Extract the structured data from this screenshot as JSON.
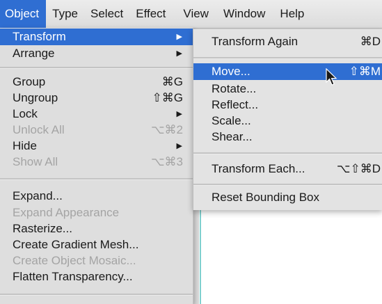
{
  "menubar": {
    "items": [
      {
        "label": "Object"
      },
      {
        "label": "Type"
      },
      {
        "label": "Select"
      },
      {
        "label": "Effect"
      },
      {
        "label": "View"
      },
      {
        "label": "Window"
      },
      {
        "label": "Help"
      }
    ]
  },
  "object_menu": {
    "items": [
      {
        "label": "Transform",
        "shortcut": "",
        "submenu": true
      },
      {
        "label": "Arrange",
        "shortcut": "",
        "submenu": true
      },
      {
        "label": "Group",
        "shortcut": "⌘G"
      },
      {
        "label": "Ungroup",
        "shortcut": "⇧⌘G"
      },
      {
        "label": "Lock",
        "shortcut": "",
        "submenu": true
      },
      {
        "label": "Unlock All",
        "shortcut": "⌥⌘2"
      },
      {
        "label": "Hide",
        "shortcut": "",
        "submenu": true
      },
      {
        "label": "Show All",
        "shortcut": "⌥⌘3"
      },
      {
        "label": "Expand...",
        "shortcut": ""
      },
      {
        "label": "Expand Appearance",
        "shortcut": ""
      },
      {
        "label": "Rasterize...",
        "shortcut": ""
      },
      {
        "label": "Create Gradient Mesh...",
        "shortcut": ""
      },
      {
        "label": "Create Object Mosaic...",
        "shortcut": ""
      },
      {
        "label": "Flatten Transparency...",
        "shortcut": ""
      }
    ],
    "submenu_arrow": "▶"
  },
  "transform_submenu": {
    "items": [
      {
        "label": "Transform Again",
        "shortcut": "⌘D"
      },
      {
        "label": "Move...",
        "shortcut": "⇧⌘M"
      },
      {
        "label": "Rotate...",
        "shortcut": ""
      },
      {
        "label": "Reflect...",
        "shortcut": ""
      },
      {
        "label": "Scale...",
        "shortcut": ""
      },
      {
        "label": "Shear...",
        "shortcut": ""
      },
      {
        "label": "Transform Each...",
        "shortcut": "⌥⇧⌘D"
      },
      {
        "label": "Reset Bounding Box",
        "shortcut": ""
      }
    ]
  },
  "colors": {
    "highlight": "#2f6ed2",
    "menu_bg": "#dedede",
    "disabled_text": "#a4a4a4",
    "canvas_guide": "#7fd0cf"
  },
  "icons": {
    "submenu_arrow": "arrow-right-icon",
    "pointer": "mouse-pointer-icon"
  }
}
